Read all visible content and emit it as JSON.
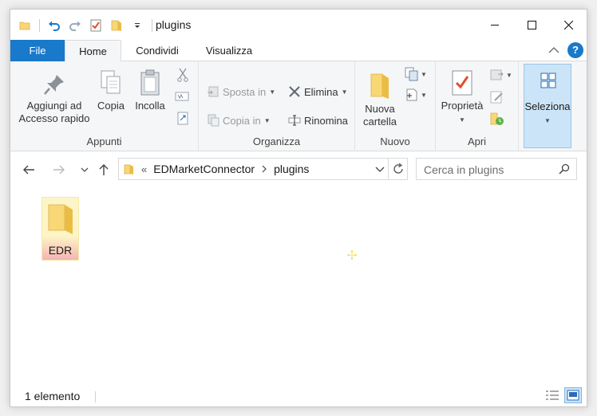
{
  "window": {
    "title": "plugins"
  },
  "tabs": {
    "file": "File",
    "home": "Home",
    "share": "Condividi",
    "view": "Visualizza"
  },
  "ribbon": {
    "clipboard": {
      "pin_label_1": "Aggiungi ad",
      "pin_label_2": "Accesso rapido",
      "copy": "Copia",
      "paste": "Incolla",
      "group": "Appunti"
    },
    "organize": {
      "move_to": "Sposta in",
      "copy_to": "Copia in",
      "delete": "Elimina",
      "rename": "Rinomina",
      "group": "Organizza"
    },
    "new": {
      "new_folder_1": "Nuova",
      "new_folder_2": "cartella",
      "group": "Nuovo"
    },
    "open": {
      "properties": "Proprietà",
      "group": "Apri"
    },
    "select": {
      "select": "Seleziona"
    }
  },
  "address": {
    "overflow": "«",
    "crumbs": [
      "EDMarketConnector",
      "plugins"
    ]
  },
  "search": {
    "placeholder": "Cerca in plugins"
  },
  "files": [
    {
      "name": "EDR",
      "type": "folder"
    }
  ],
  "status": {
    "count": "1 elemento"
  },
  "colors": {
    "accent": "#1979ca",
    "folder": "#f8d775",
    "selection": "#cce4f7"
  }
}
